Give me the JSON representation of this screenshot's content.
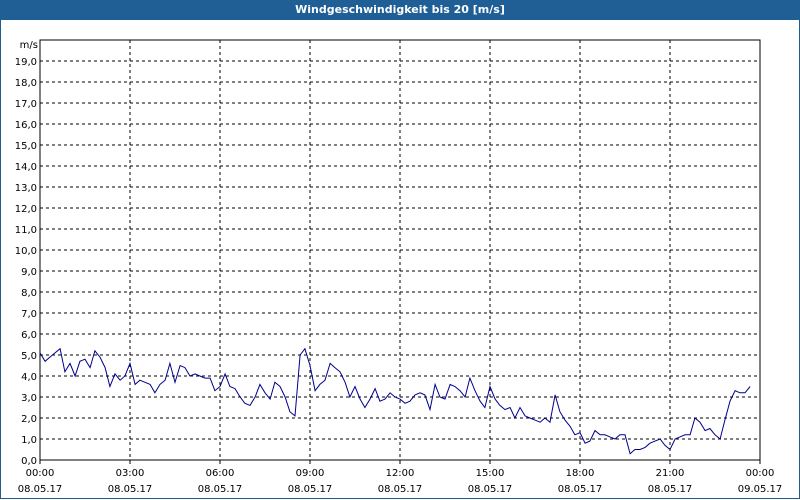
{
  "window": {
    "title": "Windgeschwindigkeit bis 20 [m/s]"
  },
  "chart_data": {
    "type": "line",
    "title": "Windgeschwindigkeit bis 20 [m/s]",
    "ylabel": "m/s",
    "ylim": [
      0,
      20
    ],
    "yticks": [
      "0,0",
      "1,0",
      "2,0",
      "3,0",
      "4,0",
      "5,0",
      "6,0",
      "7,0",
      "8,0",
      "9,0",
      "10,0",
      "11,0",
      "12,0",
      "13,0",
      "14,0",
      "15,0",
      "16,0",
      "17,0",
      "18,0",
      "19,0"
    ],
    "x_hours_range": [
      0,
      24
    ],
    "xticks": [
      {
        "time": "00:00",
        "date": "08.05.17"
      },
      {
        "time": "03:00",
        "date": "08.05.17"
      },
      {
        "time": "06:00",
        "date": "08.05.17"
      },
      {
        "time": "09:00",
        "date": "08.05.17"
      },
      {
        "time": "12:00",
        "date": "08.05.17"
      },
      {
        "time": "15:00",
        "date": "08.05.17"
      },
      {
        "time": "18:00",
        "date": "08.05.17"
      },
      {
        "time": "21:00",
        "date": "08.05.17"
      },
      {
        "time": "00:00",
        "date": "09.05.17"
      }
    ],
    "grid": true,
    "series": [
      {
        "color": "#00008b",
        "x_hours": [
          0.0,
          0.17,
          0.33,
          0.5,
          0.67,
          0.83,
          1.0,
          1.17,
          1.33,
          1.5,
          1.67,
          1.83,
          2.0,
          2.17,
          2.33,
          2.5,
          2.67,
          2.83,
          3.0,
          3.17,
          3.33,
          3.5,
          3.67,
          3.83,
          4.0,
          4.17,
          4.33,
          4.5,
          4.67,
          4.83,
          5.0,
          5.17,
          5.33,
          5.5,
          5.67,
          5.83,
          6.0,
          6.17,
          6.33,
          6.5,
          6.67,
          6.83,
          7.0,
          7.17,
          7.33,
          7.5,
          7.67,
          7.83,
          8.0,
          8.17,
          8.33,
          8.5,
          8.67,
          8.83,
          9.0,
          9.17,
          9.33,
          9.5,
          9.67,
          9.83,
          10.0,
          10.17,
          10.33,
          10.5,
          10.67,
          10.83,
          11.0,
          11.17,
          11.33,
          11.5,
          11.67,
          11.83,
          12.0,
          12.17,
          12.33,
          12.5,
          12.67,
          12.83,
          13.0,
          13.17,
          13.33,
          13.5,
          13.67,
          13.83,
          14.0,
          14.17,
          14.33,
          14.5,
          14.67,
          14.83,
          15.0,
          15.17,
          15.33,
          15.5,
          15.67,
          15.83,
          16.0,
          16.17,
          16.33,
          16.5,
          16.67,
          16.83,
          17.0,
          17.17,
          17.33,
          17.5,
          17.67,
          17.83,
          18.0,
          18.17,
          18.33,
          18.5,
          18.67,
          18.83,
          19.0,
          19.17,
          19.33,
          19.5,
          19.67,
          19.83,
          20.0,
          20.17,
          20.33,
          20.5,
          20.67,
          20.83,
          21.0,
          21.17,
          21.33,
          21.5,
          21.67,
          21.83,
          22.0,
          22.17,
          22.33,
          22.5,
          22.67,
          22.83,
          23.0,
          23.17,
          23.33,
          23.5,
          23.67,
          23.83
        ],
        "values": [
          5.1,
          4.7,
          4.9,
          5.1,
          5.3,
          4.2,
          4.6,
          4.0,
          4.7,
          4.8,
          4.4,
          5.2,
          4.9,
          4.4,
          3.5,
          4.1,
          3.8,
          4.0,
          4.6,
          3.6,
          3.8,
          3.7,
          3.6,
          3.2,
          3.6,
          3.8,
          4.6,
          3.7,
          4.5,
          4.4,
          4.0,
          4.1,
          4.0,
          3.9,
          3.9,
          3.3,
          3.5,
          4.1,
          3.5,
          3.4,
          3.0,
          2.7,
          2.6,
          3.0,
          3.6,
          3.2,
          2.9,
          3.7,
          3.5,
          3.0,
          2.3,
          2.1,
          5.0,
          5.3,
          4.5,
          3.3,
          3.6,
          3.8,
          4.6,
          4.4,
          4.2,
          3.7,
          3.0,
          3.5,
          2.9,
          2.5,
          2.9,
          3.4,
          2.8,
          2.9,
          3.2,
          3.0,
          2.9,
          2.7,
          2.8,
          3.1,
          3.2,
          3.1,
          2.4,
          3.6,
          3.0,
          2.9,
          3.6,
          3.5,
          3.3,
          3.0,
          3.9,
          3.3,
          2.8,
          2.5,
          3.5,
          2.9,
          2.6,
          2.4,
          2.5,
          2.0,
          2.5,
          2.1,
          2.0,
          1.9,
          1.8,
          2.0,
          1.8,
          3.1,
          2.3,
          1.9,
          1.6,
          1.2,
          1.3,
          0.8,
          0.9,
          1.4,
          1.2,
          1.2,
          1.1,
          1.0,
          1.2,
          1.2,
          0.3,
          0.5,
          0.5,
          0.6,
          0.8,
          0.9,
          1.0,
          0.7,
          0.5,
          1.0,
          1.1,
          1.2,
          1.2,
          2.0,
          1.8,
          1.4,
          1.5,
          1.2,
          1.0,
          1.9,
          2.8,
          3.3,
          3.2,
          3.2,
          3.5
        ]
      }
    ]
  }
}
